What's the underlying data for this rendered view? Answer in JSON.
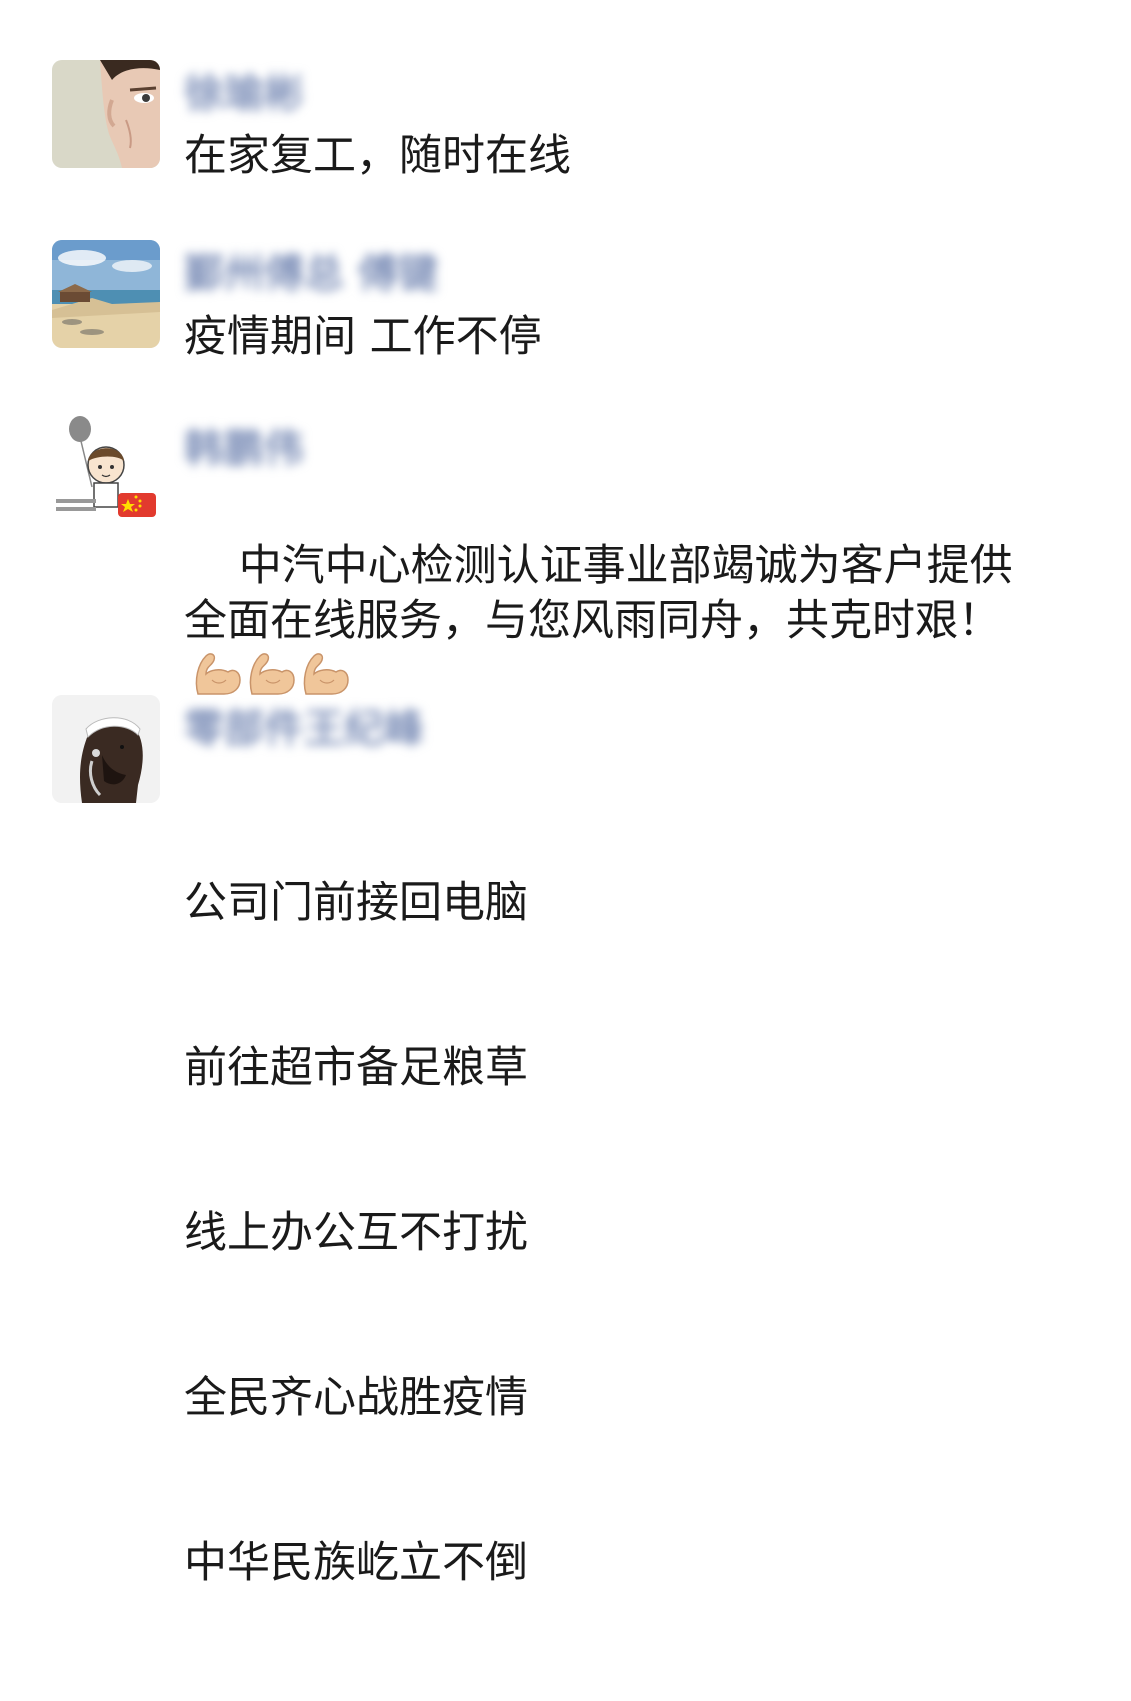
{
  "posts": [
    {
      "author": "徐瑜彬",
      "text": "在家复工，随时在线",
      "avatar_icon": "face-portrait-avatar"
    },
    {
      "author": "鄞州傅总 傅键",
      "text": "疫情期间 工作不停",
      "avatar_icon": "beach-avatar"
    },
    {
      "author": "韩鹏伟",
      "text_main": "中汽中心检测认证事业部竭诚为客户提供全面在线服务，与您风雨同舟，共克时艰！",
      "emoji": [
        "flexed-biceps-icon",
        "flexed-biceps-icon",
        "flexed-biceps-icon"
      ],
      "avatar_icon": "cartoon-boy-flag-avatar"
    },
    {
      "author": "零部件王纪峰",
      "lines": [
        "公司门前接回电脑",
        "前往超市备足粮草",
        "线上办公互不打扰",
        "全民齐心战胜疫情",
        "中华民族屹立不倒"
      ],
      "avatar_icon": "athlete-headband-avatar"
    }
  ],
  "colors": {
    "name": "#7d8fb8",
    "text": "#1a1a1a",
    "background": "#ffffff"
  }
}
